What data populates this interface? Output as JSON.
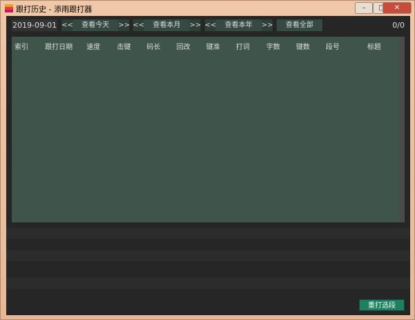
{
  "window": {
    "title": "跟打历史 - 添雨跟打器",
    "minimize": "–",
    "maximize": "□",
    "close": "✕"
  },
  "toolbar": {
    "date": "2019-09-01",
    "prev": "<<",
    "next": ">>",
    "today": "查看今天",
    "month": "查看本月",
    "year": "查看本年",
    "all": "查看全部",
    "count": "0/0"
  },
  "table": {
    "columns": [
      "索引",
      "跟打日期",
      "速度",
      "击键",
      "码长",
      "回改",
      "键准",
      "打词",
      "字数",
      "键数",
      "段号",
      "标题"
    ]
  },
  "footer": {
    "retype": "重打选段"
  }
}
